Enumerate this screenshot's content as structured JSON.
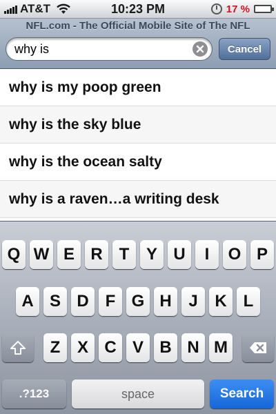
{
  "status_bar": {
    "carrier": "AT&T",
    "time": "10:23 PM",
    "battery_percent": "17 %",
    "battery_level": 0.17
  },
  "header": {
    "page_title": "NFL.com - The Official Mobile Site of The NFL",
    "search_value": "why is",
    "cancel_label": "Cancel"
  },
  "suggestions": [
    "why is my poop green",
    "why is the sky blue",
    "why is the ocean salty",
    "why is a raven…a writing desk"
  ],
  "keyboard": {
    "row1": [
      "Q",
      "W",
      "E",
      "R",
      "T",
      "Y",
      "U",
      "I",
      "O",
      "P"
    ],
    "row2": [
      "A",
      "S",
      "D",
      "F",
      "G",
      "H",
      "J",
      "K",
      "L"
    ],
    "row3": [
      "Z",
      "X",
      "C",
      "V",
      "B",
      "N",
      "M"
    ],
    "mode_label": ".?123",
    "space_label": "space",
    "go_label": "Search"
  },
  "icons": {
    "shift": "shift-icon",
    "delete": "backspace-icon",
    "clear": "clear-icon",
    "wifi": "wifi-icon"
  },
  "colors": {
    "search_button": "#1d6fe0",
    "battery_low": "#d01020"
  }
}
